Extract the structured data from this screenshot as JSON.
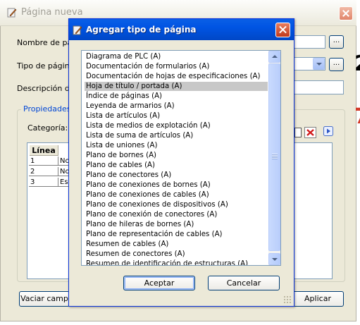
{
  "background_dialog": {
    "title": "Página nueva",
    "labels": {
      "nombre": "Nombre de pág",
      "tipo": "Tipo de página",
      "descripcion": "Descripción de",
      "propiedades": "Propiedades",
      "categoria": "Categoría:"
    },
    "browse_button_label": "...",
    "grid": {
      "column_header": "Línea",
      "rows": [
        {
          "num": "1",
          "value": "No"
        },
        {
          "num": "2",
          "value": "No"
        },
        {
          "num": "3",
          "value": "Es"
        }
      ]
    },
    "buttons": {
      "vaciar": "Vaciar camp",
      "aplicar": "Aplicar"
    },
    "edge_characters": {
      "right_1": "2",
      "right_2": "7"
    }
  },
  "modal": {
    "title": "Agregar tipo de página",
    "items": [
      "Diagrama de PLC (A)",
      "Documentación de formularios (A)",
      "Documentación de hojas de especificaciones (A)",
      "Hoja de título / portada (A)",
      "Índice de páginas (A)",
      "Leyenda de armarios (A)",
      "Lista de artículos (A)",
      "Lista de medios de explotación (A)",
      "Lista de suma de artículos (A)",
      "Lista de uniones (A)",
      "Plano de bornes (A)",
      "Plano de cables (A)",
      "Plano de conectores (A)",
      "Plano de conexiones de bornes (A)",
      "Plano de conexiones de cables (A)",
      "Plano de conexiones de dispositivos (A)",
      "Plano de conexión de conectores (A)",
      "Plano de hileras de bornes (A)",
      "Plano de representación de cables (A)",
      "Resumen de cables (A)",
      "Resumen de conectores (A)",
      "Resumen de identificación de estructuras (A)"
    ],
    "selected_index": 3,
    "accept_label": "Aceptar",
    "cancel_label": "Cancelar"
  },
  "colors": {
    "title_bar": "#0054e3",
    "dialog_bg": "#ece9d8",
    "selection": "#c8c8c8",
    "group_legend": "#0046d5"
  }
}
